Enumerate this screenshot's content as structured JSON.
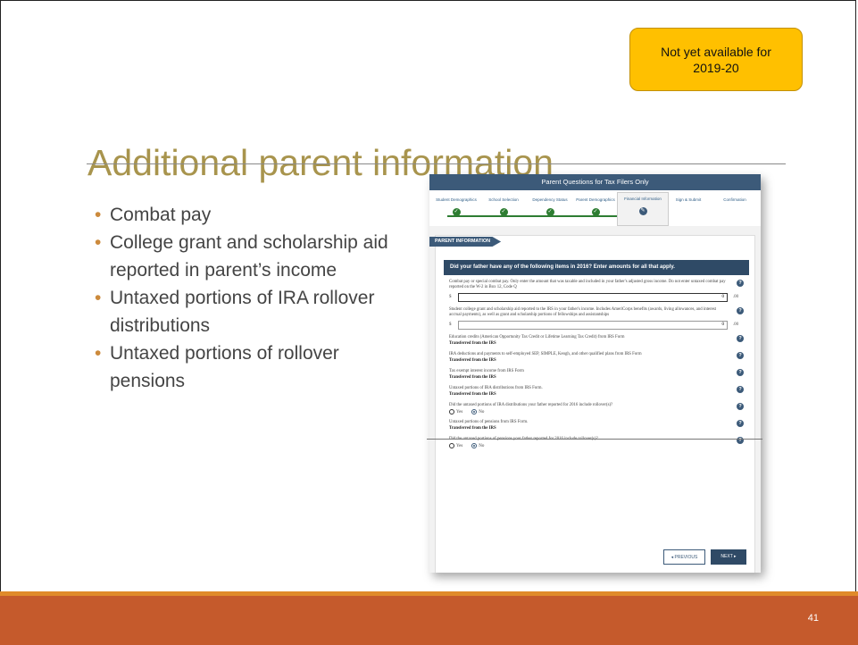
{
  "badge": {
    "line1": "Not yet available for",
    "line2": "2019-20"
  },
  "slide": {
    "title": "Additional parent information",
    "bullets": [
      "Combat pay",
      "College grant and scholarship aid reported in parent’s income",
      "Untaxed portions of IRA rollover distributions",
      "Untaxed portions of rollover pensions"
    ],
    "page_number": "41"
  },
  "screenshot": {
    "header": "Parent Questions for Tax Filers Only",
    "steps": [
      {
        "label": "Student Demographics"
      },
      {
        "label": "School Selection"
      },
      {
        "label": "Dependency Status"
      },
      {
        "label": "Parent Demographics"
      },
      {
        "label": "Financial Information"
      },
      {
        "label": "Sign & Submit"
      },
      {
        "label": "Confirmation"
      }
    ],
    "section_tag": "PARENT INFORMATION",
    "question_bar": "Did your father have any of the following items in 2016? Enter amounts for all that apply.",
    "fields": {
      "combat": {
        "text": "Combat pay or special combat pay. Only enter the amount that was taxable and included in your father's adjusted gross income. Do not enter untaxed combat pay reported on the W-2 in Box 12, Code Q",
        "currency": "$",
        "value": "0",
        "cents": ".00"
      },
      "grant": {
        "text": "Student college grant and scholarship aid reported to the IRS in your father's income. Includes AmeriCorps benefits (awards, living allowances, and interest accrual payments), as well as grant and scholarship portions of fellowships and assistantships",
        "currency": "$",
        "value": "0",
        "cents": ".00"
      },
      "edu": {
        "text": "Education credits (American Opportunity Tax Credit or Lifetime Learning Tax Credit) from IRS Form",
        "value": "Transferred from the IRS"
      },
      "ira_ded": {
        "text": "IRA deductions and payments to self-employed SEP, SIMPLE, Keogh, and other qualified plans from IRS Form",
        "value": "Transferred from the IRS"
      },
      "tax_exempt": {
        "text": "Tax exempt interest income from IRS Form",
        "value": "Transferred from the IRS"
      },
      "untaxed_ira": {
        "text": "Untaxed portions of IRA distributions from IRS Form.",
        "value": "Transferred from the IRS"
      },
      "ira_rollover": {
        "text": "Did the untaxed portions of IRA distributions your father reported for 2016 include rollover(s)?",
        "yes": "Yes",
        "no": "No"
      },
      "untaxed_pensions": {
        "text": "Untaxed portions of pensions from IRS Form.",
        "value": "Transferred from the IRS"
      },
      "pension_rollover": {
        "text": "Did the untaxed portions of pensions your father reported for 2016 include rollover(s)?",
        "yes": "Yes",
        "no": "No"
      }
    },
    "buttons": {
      "previous": "PREVIOUS",
      "next": "NEXT"
    },
    "help_glyph": "?"
  },
  "colors": {
    "title": "#a8944d",
    "badge": "#ffc000",
    "footer": "#c55a2c",
    "header_blue": "#3c5a79"
  }
}
